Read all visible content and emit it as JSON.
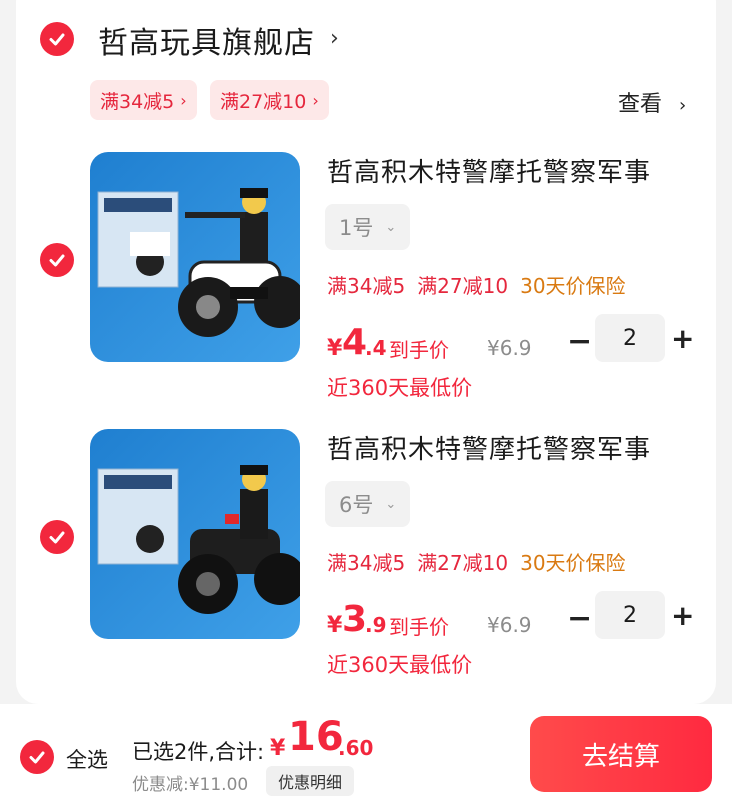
{
  "colors": {
    "accent": "#f2273d",
    "promo_orange": "#d97a12",
    "muted": "#8c8c8c"
  },
  "store": {
    "name": "哲高玩具旗舰店",
    "arrow": "›",
    "promos": [
      "满34减5",
      "满27减10"
    ],
    "promo_chev": "›",
    "view_label": "查看",
    "view_chev": "›"
  },
  "items": [
    {
      "title": "哲高积木特警摩托警察军事",
      "variant": "1号",
      "promos": [
        "满34减5",
        "满27减10"
      ],
      "guarantee": "30天价保险",
      "yen": "¥",
      "price_int": "4",
      "price_dec": ".4",
      "price_label": "到手价",
      "orig_price": "¥6.9",
      "quantity": "2",
      "lowest": "近360天最低价",
      "image_icon": "police-motorcycle-toy-white"
    },
    {
      "title": "哲高积木特警摩托警察军事",
      "variant": "6号",
      "promos": [
        "满34减5",
        "满27减10"
      ],
      "guarantee": "30天价保险",
      "yen": "¥",
      "price_int": "3",
      "price_dec": ".9",
      "price_label": "到手价",
      "orig_price": "¥6.9",
      "quantity": "2",
      "lowest": "近360天最低价",
      "image_icon": "police-motorcycle-toy-black"
    }
  ],
  "qty_controls": {
    "minus": "−",
    "plus": "+"
  },
  "footer": {
    "select_all": "全选",
    "selected_text": "已选2件,合计:",
    "total_yen": "¥",
    "total_int": "16",
    "total_dec": ".60",
    "discount_text": "优惠减:¥11.00",
    "discount_detail": "优惠明细",
    "checkout": "去结算"
  }
}
